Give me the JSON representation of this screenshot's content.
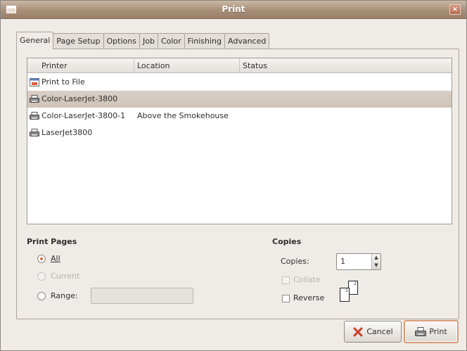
{
  "window": {
    "title": "Print",
    "close_glyph": "×"
  },
  "tabs": [
    {
      "label": "General",
      "active": true
    },
    {
      "label": "Page Setup"
    },
    {
      "label": "Options"
    },
    {
      "label": "Job"
    },
    {
      "label": "Color"
    },
    {
      "label": "Finishing"
    },
    {
      "label": "Advanced"
    }
  ],
  "printer_list": {
    "columns": [
      "Printer",
      "Location",
      "Status"
    ],
    "rows": [
      {
        "name": "Print to File",
        "location": "",
        "status": "",
        "icon": "file-icon"
      },
      {
        "name": "Color-LaserJet-3800",
        "location": "",
        "status": "",
        "icon": "printer-icon",
        "selected": true
      },
      {
        "name": "Color-LaserJet-3800-1",
        "location": "Above the Smokehouse",
        "status": "",
        "icon": "printer-icon"
      },
      {
        "name": "LaserJet3800",
        "location": "",
        "status": "",
        "icon": "printer-icon"
      }
    ]
  },
  "print_pages": {
    "title": "Print Pages",
    "all_label": "All",
    "current_label": "Current",
    "range_label": "Range:",
    "range_value": "",
    "selected": "all"
  },
  "copies": {
    "title": "Copies",
    "copies_label": "Copies:",
    "copies_value": "1",
    "collate_label": "Collate",
    "reverse_label": "Reverse",
    "collate_enabled": false,
    "reverse_checked": false
  },
  "buttons": {
    "cancel": "Cancel",
    "print": "Print"
  },
  "colors": {
    "accent": "#d86b3c",
    "selection": "#d3c8bd",
    "titlebar": "#a88f78"
  }
}
